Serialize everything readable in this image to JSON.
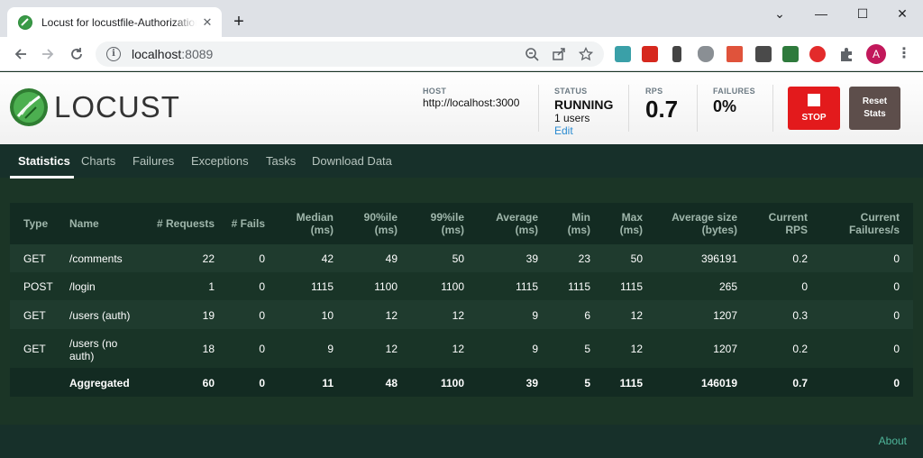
{
  "browser": {
    "tab_title": "Locust for locustfile-Authorization",
    "tab_close": "✕",
    "new_tab": "+",
    "url_host": "localhost",
    "url_port": ":8089",
    "window_controls": {
      "collapse": "⌄",
      "minimize": "—",
      "maximize": "☐",
      "close": "✕"
    },
    "avatar_letter": "A",
    "icons": [
      "back-icon",
      "forward-icon",
      "reload-icon",
      "info-icon",
      "zoom-icon",
      "share-icon",
      "star-icon",
      "puzzle-icon",
      "kebab-menu-icon"
    ]
  },
  "header": {
    "logo_text": "LOCUST",
    "host_label": "HOST",
    "host_value": "http://localhost:3000",
    "status_label": "STATUS",
    "status_value": "RUNNING",
    "users_value": "1 users",
    "edit_label": "Edit",
    "rps_label": "RPS",
    "rps_value": "0.7",
    "failures_label": "FAILURES",
    "failures_value": "0%",
    "stop_label": "STOP",
    "reset_label_1": "Reset",
    "reset_label_2": "Stats"
  },
  "nav": {
    "tabs": [
      "Statistics",
      "Charts",
      "Failures",
      "Exceptions",
      "Tasks",
      "Download Data"
    ],
    "active": "Statistics"
  },
  "table": {
    "headers": {
      "type": "Type",
      "name": "Name",
      "requests": "# Requests",
      "fails": "# Fails",
      "median_1": "Median",
      "median_2": "(ms)",
      "p90_1": "90%ile",
      "p90_2": "(ms)",
      "p99_1": "99%ile",
      "p99_2": "(ms)",
      "avg_1": "Average",
      "avg_2": "(ms)",
      "min_1": "Min",
      "min_2": "(ms)",
      "max_1": "Max",
      "max_2": "(ms)",
      "size_1": "Average size",
      "size_2": "(bytes)",
      "rps_1": "Current",
      "rps_2": "RPS",
      "cf_1": "Current",
      "cf_2": "Failures/s"
    },
    "rows": [
      {
        "type": "GET",
        "name": "/comments",
        "name2": "",
        "requests": "22",
        "fails": "0",
        "median": "42",
        "p90": "49",
        "p99": "50",
        "avg": "39",
        "min": "23",
        "max": "50",
        "size": "396191",
        "rps": "0.2",
        "cf": "0"
      },
      {
        "type": "POST",
        "name": "/login",
        "name2": "",
        "requests": "1",
        "fails": "0",
        "median": "1115",
        "p90": "1100",
        "p99": "1100",
        "avg": "1115",
        "min": "1115",
        "max": "1115",
        "size": "265",
        "rps": "0",
        "cf": "0"
      },
      {
        "type": "GET",
        "name": "/users (auth)",
        "name2": "",
        "requests": "19",
        "fails": "0",
        "median": "10",
        "p90": "12",
        "p99": "12",
        "avg": "9",
        "min": "6",
        "max": "12",
        "size": "1207",
        "rps": "0.3",
        "cf": "0"
      },
      {
        "type": "GET",
        "name": "/users (no",
        "name2": "auth)",
        "requests": "18",
        "fails": "0",
        "median": "9",
        "p90": "12",
        "p99": "12",
        "avg": "9",
        "min": "5",
        "max": "12",
        "size": "1207",
        "rps": "0.2",
        "cf": "0"
      }
    ],
    "aggregated": {
      "type": "",
      "name": "Aggregated",
      "requests": "60",
      "fails": "0",
      "median": "11",
      "p90": "48",
      "p99": "1100",
      "avg": "39",
      "min": "5",
      "max": "1115",
      "size": "146019",
      "rps": "0.7",
      "cf": "0"
    },
    "row_colors": [
      "#1f3b2e",
      "#193427"
    ]
  },
  "footer": {
    "about": "About"
  }
}
